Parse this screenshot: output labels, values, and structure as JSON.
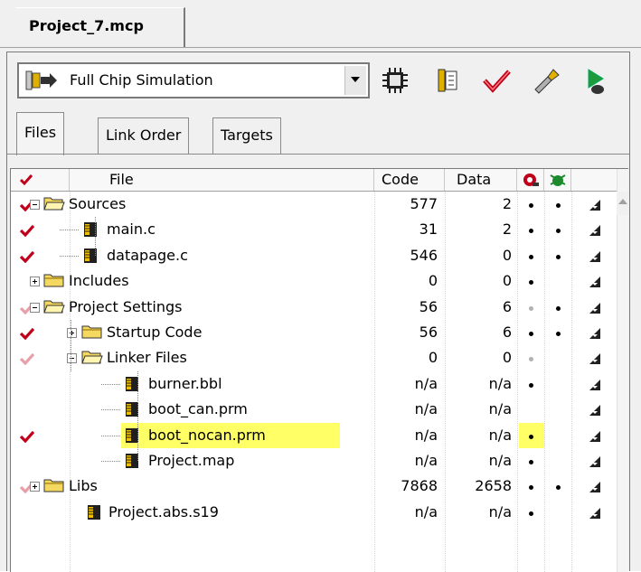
{
  "window": {
    "tab_title": "Project_7.mcp"
  },
  "toolbar": {
    "target": "Full Chip Simulation",
    "buttons": [
      "chip-icon",
      "settings-icon",
      "check-icon",
      "wrench-icon",
      "debug-icon"
    ]
  },
  "tabs": [
    {
      "label": "Files",
      "active": true
    },
    {
      "label": "Link Order",
      "active": false
    },
    {
      "label": "Targets",
      "active": false
    }
  ],
  "columns": {
    "file": "File",
    "code": "Code",
    "data": "Data"
  },
  "rows": [
    {
      "name": "Sources",
      "code": "577",
      "data": "2",
      "dbg": "black",
      "ext": true,
      "check": "red",
      "level": 0,
      "type": "folder-open",
      "expander": "minus"
    },
    {
      "name": "main.c",
      "code": "31",
      "data": "2",
      "dbg": "black",
      "ext": true,
      "check": "red",
      "level": 1,
      "type": "file",
      "expander": ""
    },
    {
      "name": "datapage.c",
      "code": "546",
      "data": "0",
      "dbg": "black",
      "ext": true,
      "check": "red",
      "level": 1,
      "type": "file",
      "expander": ""
    },
    {
      "name": "Includes",
      "code": "0",
      "data": "0",
      "dbg": "black",
      "ext": false,
      "check": "",
      "level": 0,
      "type": "folder",
      "expander": "plus"
    },
    {
      "name": "Project Settings",
      "code": "56",
      "data": "6",
      "dbg": "gray",
      "ext": true,
      "check": "faded",
      "level": 0,
      "type": "folder-open",
      "expander": "minus"
    },
    {
      "name": "Startup Code",
      "code": "56",
      "data": "6",
      "dbg": "black",
      "ext": true,
      "check": "red",
      "level": 1,
      "type": "folder",
      "expander": "plus"
    },
    {
      "name": "Linker Files",
      "code": "0",
      "data": "0",
      "dbg": "gray",
      "ext": false,
      "check": "faded",
      "level": 1,
      "type": "folder-open",
      "expander": "minus"
    },
    {
      "name": "burner.bbl",
      "code": "n/a",
      "data": "n/a",
      "dbg": "black",
      "ext": false,
      "check": "",
      "level": 2,
      "type": "file",
      "expander": ""
    },
    {
      "name": "boot_can.prm",
      "code": "n/a",
      "data": "n/a",
      "dbg": "",
      "ext": false,
      "check": "",
      "level": 2,
      "type": "file",
      "expander": ""
    },
    {
      "name": "boot_nocan.prm",
      "code": "n/a",
      "data": "n/a",
      "dbg": "black",
      "ext": false,
      "check": "red",
      "level": 2,
      "type": "file",
      "expander": "",
      "highlight": true
    },
    {
      "name": "Project.map",
      "code": "n/a",
      "data": "n/a",
      "dbg": "black",
      "ext": false,
      "check": "",
      "level": 2,
      "type": "file",
      "expander": ""
    },
    {
      "name": "Libs",
      "code": "7868",
      "data": "2658",
      "dbg": "black",
      "ext": true,
      "check": "faded",
      "level": 0,
      "type": "folder",
      "expander": "plus"
    },
    {
      "name": "Project.abs.s19",
      "code": "n/a",
      "data": "n/a",
      "dbg": "black",
      "ext": false,
      "check": "",
      "level": -1,
      "type": "file",
      "expander": ""
    }
  ],
  "colors": {
    "highlight": "#ffff66",
    "check_red": "#c0001a",
    "check_faded": "#e8a0a8",
    "folder": "#f5d860"
  }
}
